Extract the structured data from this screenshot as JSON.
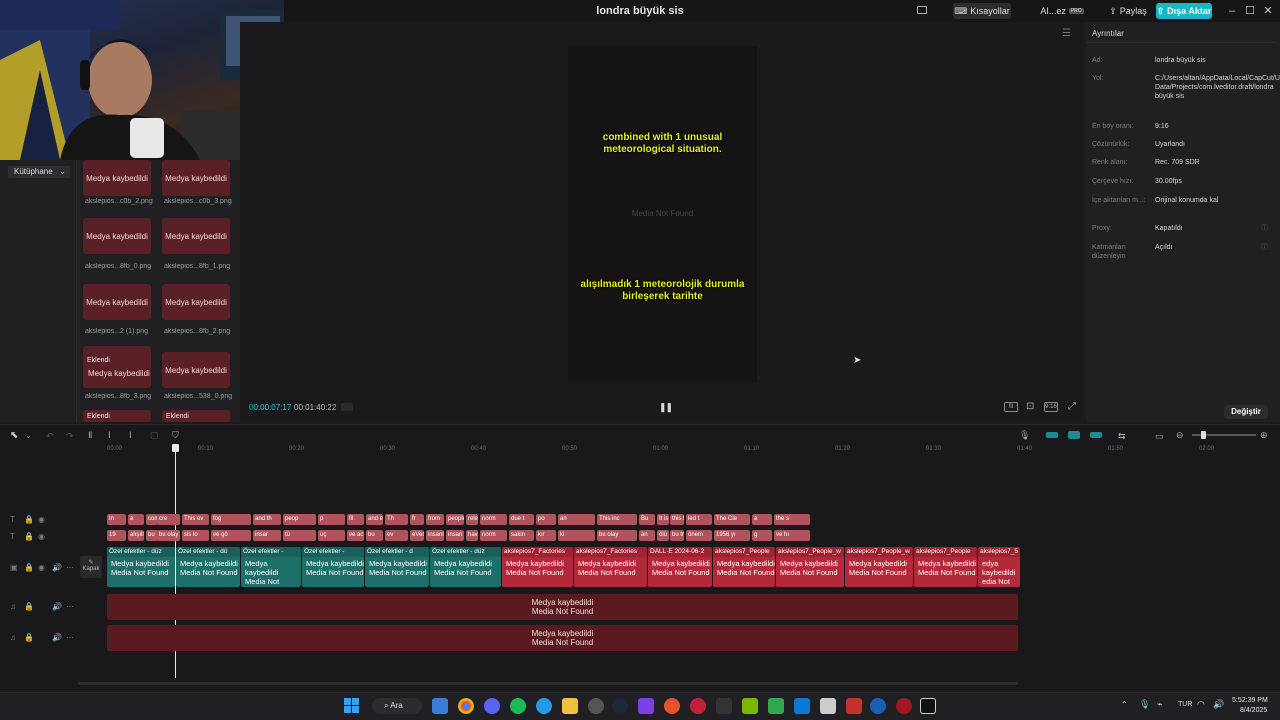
{
  "titlebar": {
    "title": "londra büyük sis",
    "shortcuts_label": "Kısayollar",
    "ai_label": "AI...ez",
    "share_label": "Paylaş",
    "export_label": "Dışa Aktar"
  },
  "library": {
    "tab_label": "Kütüphane",
    "media_missing_label": "Medya kaybedildi",
    "added_label": "Eklendi",
    "files": [
      "akslepios...c0b_2.png",
      "akslepios...c0b_3.png",
      "akslepios...8fb_0.png",
      "akslepios...8fb_1.png",
      "akslepios...2 (1).png",
      "akslepios...8fb_2.png",
      "akslepios...8fb_3.png",
      "akslepios...538_0.png"
    ]
  },
  "preview": {
    "subtitle_en": "combined with 1 unusual meteorological situation.",
    "subtitle_tr": "alışılmadık 1 meteorolojik durumla birleşerek tarihte",
    "media_not_found": "Media Not Found",
    "time_current": "00:00:07:17",
    "time_total": "00:01:40:22"
  },
  "details": {
    "title": "Ayrıntılar",
    "rows": [
      {
        "label": "Ad:",
        "value": "londra büyük sis"
      },
      {
        "label": "Yol:",
        "value": "C:/Users/altan/AppData/Local/CapCut/User Data/Projects/com.lveditor.draft/londra büyük sis"
      },
      {
        "label": "En boy oranı:",
        "value": "9:16"
      },
      {
        "label": "Çözünürlük:",
        "value": "Uyarlandı"
      },
      {
        "label": "Renk alanı:",
        "value": "Rec. 709 SDR"
      },
      {
        "label": "Çerçeve hızı:",
        "value": "30.00fps"
      },
      {
        "label": "İçe aktarılan m...:",
        "value": "Orijinal konumda kal"
      },
      {
        "label": "Proxy:",
        "value": "Kapatıldı"
      },
      {
        "label": "Katmanları düzenleyin",
        "value": "Açıldı"
      }
    ],
    "change_label": "Değiştir"
  },
  "timeline": {
    "ticks": [
      "00:00",
      "00:10",
      "00:20",
      "00:30",
      "00:40",
      "00:50",
      "01:00",
      "01:10",
      "01:20",
      "01:30",
      "01:40",
      "01:50",
      "02:00"
    ],
    "cover_label": "Kapak",
    "text_track_1": [
      "In",
      "a",
      "combi",
      "cre",
      "This ev",
      "fog",
      "and th",
      "peop",
      "p",
      "fil",
      "and em",
      "Th",
      "fr",
      "from",
      "people",
      "releas",
      "norm",
      "due t",
      "po",
      "an",
      "This inc",
      "Bu",
      "It is es",
      "this b",
      "led t",
      "The Cle",
      "a",
      "the s"
    ],
    "text_track_2": [
      "19",
      "alışılma",
      "bu",
      "bu olay",
      "sis lo",
      "ve gö",
      "insar",
      "tü",
      "uç",
      "ve acıl",
      "bu",
      "ev",
      "eVer",
      "insanl",
      "insan",
      "havaya",
      "norm",
      "sakin",
      "kır",
      "ki",
      "bu olay",
      "an",
      "ölü say",
      "bu tra",
      "önem",
      "1956 yı",
      "g",
      "ve hı"
    ],
    "main_clips": [
      {
        "header": "Özel efektler - düz",
        "l1": "Medya kaybedildi",
        "l2": "Media Not Found",
        "type": "fx"
      },
      {
        "header": "Özel efektler - dü",
        "l1": "Medya kaybedildi",
        "l2": "Media Not Found",
        "type": "fx"
      },
      {
        "header": "Özel efektler -",
        "l1": "Medya kaybedildi",
        "l2": "Media Not Found",
        "type": "fx"
      },
      {
        "header": "Özel efektler -",
        "l1": "Medya kaybedildi",
        "l2": "Media Not Found",
        "type": "fx"
      },
      {
        "header": "Özel efektler - d",
        "l1": "Medya kaybedildi",
        "l2": "Media Not Found",
        "type": "fx"
      },
      {
        "header": "Özel efektler - düz",
        "l1": "Medya kaybedildi",
        "l2": "Media Not Found",
        "type": "fx"
      },
      {
        "header": "akslepios7_Factories",
        "l1": "Medya kaybedildi",
        "l2": "Media Not Found",
        "type": "media"
      },
      {
        "header": "akslepios7_Factories",
        "l1": "Medya kaybedildi",
        "l2": "Media Not Found",
        "type": "media"
      },
      {
        "header": "DALL·E 2024-06-2",
        "l1": "Medya kaybedildi",
        "l2": "Media Not Found",
        "type": "media"
      },
      {
        "header": "akslepios7_People",
        "l1": "Medya kaybedildi",
        "l2": "Media Not Found",
        "type": "media"
      },
      {
        "header": "akslepios7_People_w",
        "l1": "Medya kaybedildi",
        "l2": "Media Not Found",
        "type": "media"
      },
      {
        "header": "akslepios7_People_w",
        "l1": "Medya kaybedildi",
        "l2": "Media Not Found",
        "type": "media"
      },
      {
        "header": "akslepios7_People",
        "l1": "Medya kaybedildi",
        "l2": "Media Not Found",
        "type": "media"
      },
      {
        "header": "akslepios7_5",
        "l1": "edya kaybedildi",
        "l2": "edia Not Found",
        "type": "media"
      }
    ],
    "audio_l1": "Medya kaybedildi",
    "audio_l2": "Media Not Found"
  },
  "taskbar": {
    "search_label": "Ara",
    "lang": "TUR",
    "time": "5:52:39 PM",
    "date": "8/4/2025"
  },
  "colors": {
    "accent": "#1ab5c7",
    "missing_media": "#5b1f27",
    "fx_clip": "#1e6f6a",
    "media_clip": "#b3293a",
    "text_clip": "#b0545b",
    "subtitle": "#e8f020"
  }
}
